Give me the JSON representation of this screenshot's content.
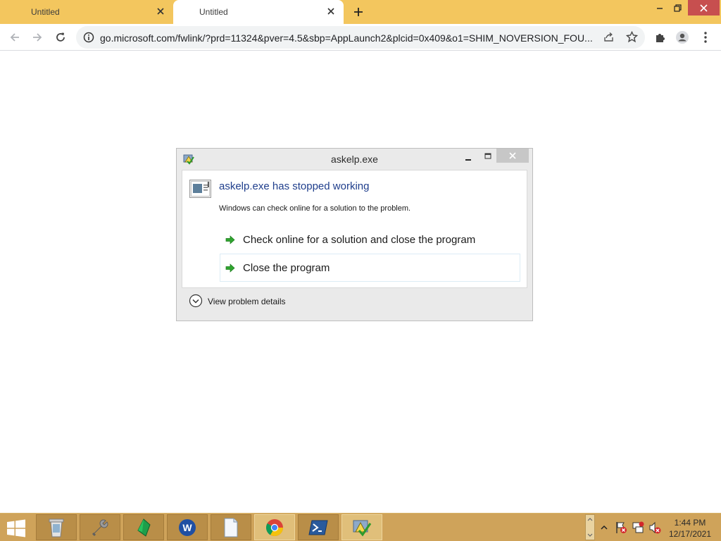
{
  "browser": {
    "tabs": [
      {
        "title": "Untitled",
        "active": false
      },
      {
        "title": "Untitled",
        "active": true
      }
    ],
    "address_bar": {
      "url": "go.microsoft.com/fwlink/?prd=11324&pver=4.5&sbp=AppLaunch2&plcid=0x409&o1=SHIM_NOVERSION_FOU..."
    },
    "colors": {
      "tabstrip": "#f3c65e",
      "close_hover": "#c74f4f"
    }
  },
  "dialog": {
    "title": "askelp.exe",
    "heading": "askelp.exe has stopped working",
    "description": "Windows can check online for a solution to the problem.",
    "options": [
      {
        "label": "Check online for a solution and close the program"
      },
      {
        "label": "Close the program"
      }
    ],
    "details_label": "View problem details",
    "icons": {
      "app": "error-reporting-icon",
      "program": "program-window-icon",
      "option": "green-arrow-icon",
      "details": "chevron-down-circle-icon"
    }
  },
  "taskbar": {
    "items": [
      {
        "name": "recycle-bin"
      },
      {
        "name": "tools"
      },
      {
        "name": "green-gem-app"
      },
      {
        "name": "wps-writer"
      },
      {
        "name": "notepad"
      },
      {
        "name": "chrome"
      },
      {
        "name": "powershell"
      },
      {
        "name": "error-reporting"
      }
    ],
    "clock": {
      "time": "1:44 PM",
      "date": "12/17/2021"
    },
    "colors": {
      "bar": "#cfa35a"
    }
  }
}
